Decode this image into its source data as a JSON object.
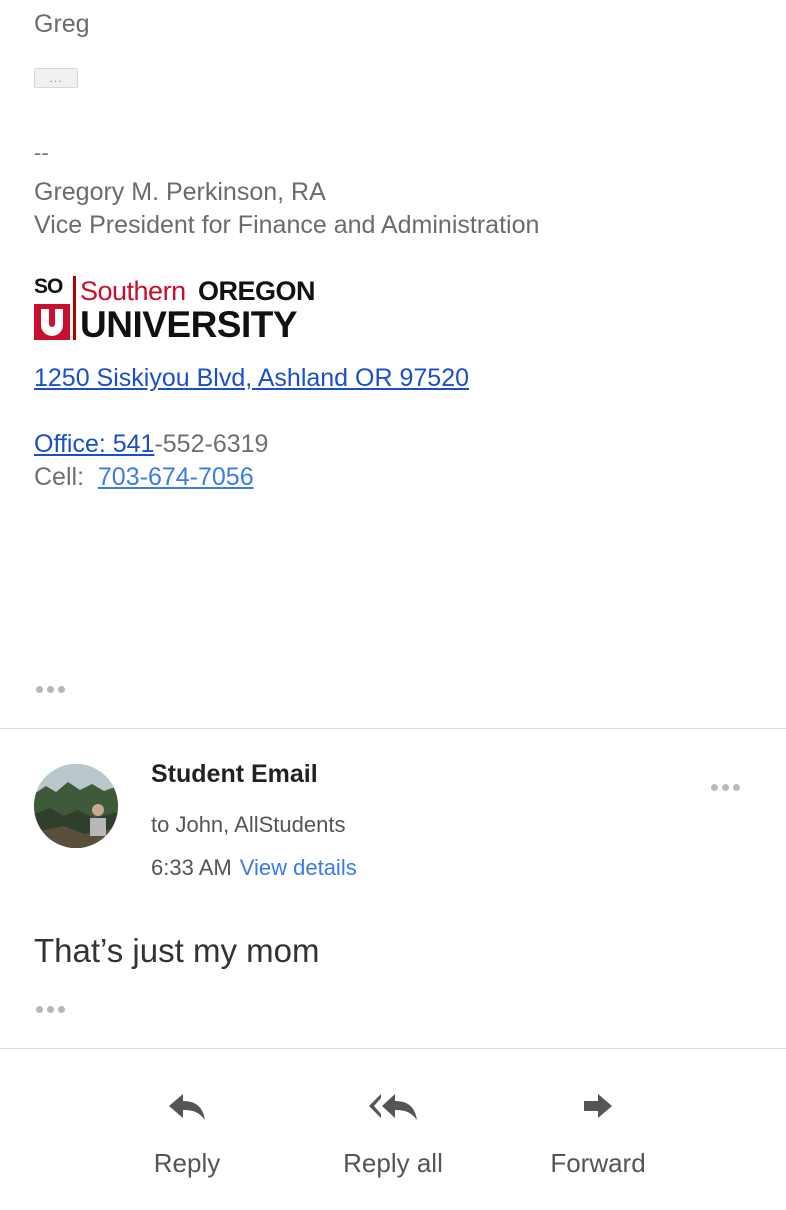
{
  "email_top": {
    "greeting": "Greg",
    "trimmed_content_label": "..."
  },
  "signature": {
    "separator": "--",
    "name": "Gregory M. Perkinson, RA",
    "title": "Vice President for Finance and Administration",
    "logo": {
      "so": "SO",
      "southern": "Southern",
      "oregon": "OREGON",
      "university": "UNIVERSITY",
      "u_mark": "U"
    },
    "address": "1250 Siskiyou Blvd, Ashland  OR 97520",
    "office_label_link": "Office: 541",
    "office_rest": "-552-6319",
    "cell_label": "Cell:  ",
    "cell_number": "703-674-7056"
  },
  "message": {
    "sender": "Student Email",
    "recipients": "to John, AllStudents",
    "time": "6:33 AM",
    "view_details": "View details",
    "body": "That’s just my mom"
  },
  "actions": {
    "reply": "Reply",
    "reply_all": "Reply all",
    "forward": "Forward"
  },
  "colors": {
    "link": "#1a4fc9",
    "brand_red": "#c8102e",
    "accent_blue": "#3b7be6"
  }
}
